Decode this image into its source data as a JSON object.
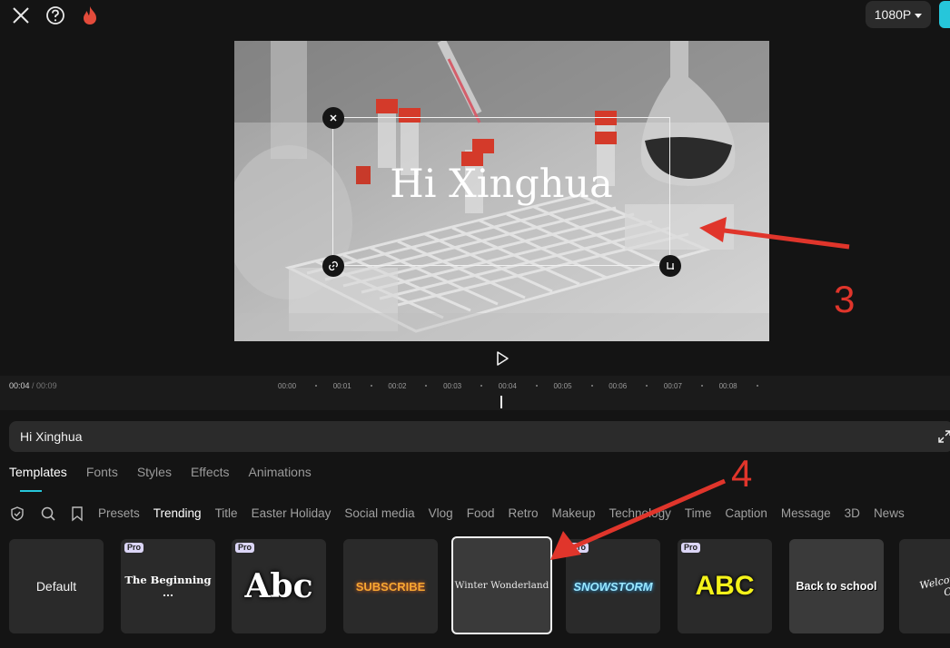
{
  "topbar": {
    "close_icon": "close-icon",
    "help_icon": "help-icon",
    "fire_icon": "fire-icon",
    "resolution": "1080P"
  },
  "preview": {
    "overlay_text": "Hi Xinghua"
  },
  "timeline": {
    "current": "00:04",
    "separator": " / ",
    "total": "00:09",
    "ticks": [
      "00:00",
      "00:01",
      "00:02",
      "00:03",
      "00:04",
      "00:05",
      "00:06",
      "00:07",
      "00:08"
    ]
  },
  "text_input": {
    "value": "Hi Xinghua"
  },
  "tabs": [
    "Templates",
    "Fonts",
    "Styles",
    "Effects",
    "Animations"
  ],
  "categories": [
    "Presets",
    "Trending",
    "Title",
    "Easter Holiday",
    "Social media",
    "Vlog",
    "Food",
    "Retro",
    "Makeup",
    "Technology",
    "Time",
    "Caption",
    "Message",
    "3D",
    "News"
  ],
  "active_category": "Trending",
  "templates": [
    {
      "label": "Default",
      "pro": ""
    },
    {
      "label": "The Beginning ...",
      "pro": "Pro"
    },
    {
      "label": "Abc",
      "pro": "Pro"
    },
    {
      "label": "SUBSCRIBE",
      "pro": ""
    },
    {
      "label": "Winter Wonderland",
      "pro": ""
    },
    {
      "label": "SNOWSTORM",
      "pro": "Pro"
    },
    {
      "label": "ABC",
      "pro": "Pro"
    },
    {
      "label": "Back to school",
      "pro": ""
    },
    {
      "label": "Welcome My Cha",
      "pro": ""
    }
  ],
  "annotations": {
    "a3": "3",
    "a4": "4"
  },
  "colors": {
    "accent": "#26c6da",
    "arrow": "#e0352b"
  }
}
